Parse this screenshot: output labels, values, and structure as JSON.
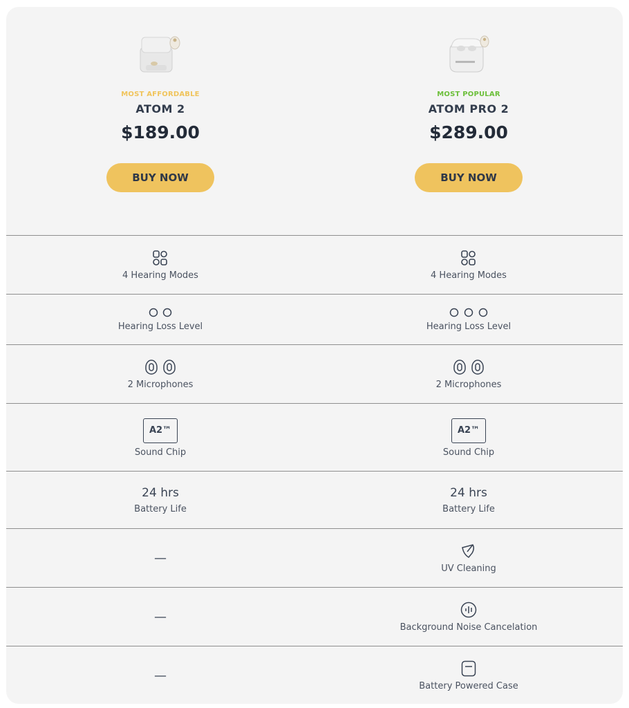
{
  "products": [
    {
      "tag": "MOST AFFORDABLE",
      "name": "ATOM 2",
      "price": "$189.00",
      "button": "BUY NOW",
      "tag_color": "#f0c45c"
    },
    {
      "tag": "MOST POPULAR",
      "name": "ATOM PRO 2",
      "price": "$289.00",
      "button": "BUY NOW",
      "tag_color": "#6cbf3a"
    }
  ],
  "features": {
    "modes": {
      "left": "4 Hearing Modes",
      "right": "4 Hearing Modes",
      "icon": "grid-modes-icon"
    },
    "loss": {
      "left": "Hearing Loss Level",
      "right": "Hearing Loss Level",
      "icon": "circle-level-icon"
    },
    "mics": {
      "left": "2 Microphones",
      "right": "2 Microphones",
      "icon": "microphone-icon"
    },
    "chip": {
      "left": "Sound Chip",
      "right": "Sound Chip",
      "chip_text": "A2™",
      "icon": "chip-icon"
    },
    "battery": {
      "left_value": "24 hrs",
      "right_value": "24 hrs",
      "left": "Battery Life",
      "right": "Battery Life"
    },
    "uv": {
      "left": "—",
      "right": "UV Cleaning",
      "icon": "uv-light-icon"
    },
    "noise": {
      "left": "—",
      "right": "Background Noise Cancelation",
      "icon": "noise-cancel-icon"
    },
    "case": {
      "left": "—",
      "right": "Battery Powered Case",
      "icon": "battery-case-icon"
    }
  },
  "colors": {
    "button": "#efc35e",
    "card_bg": "#f4f4f4",
    "text": "#3a4454"
  }
}
